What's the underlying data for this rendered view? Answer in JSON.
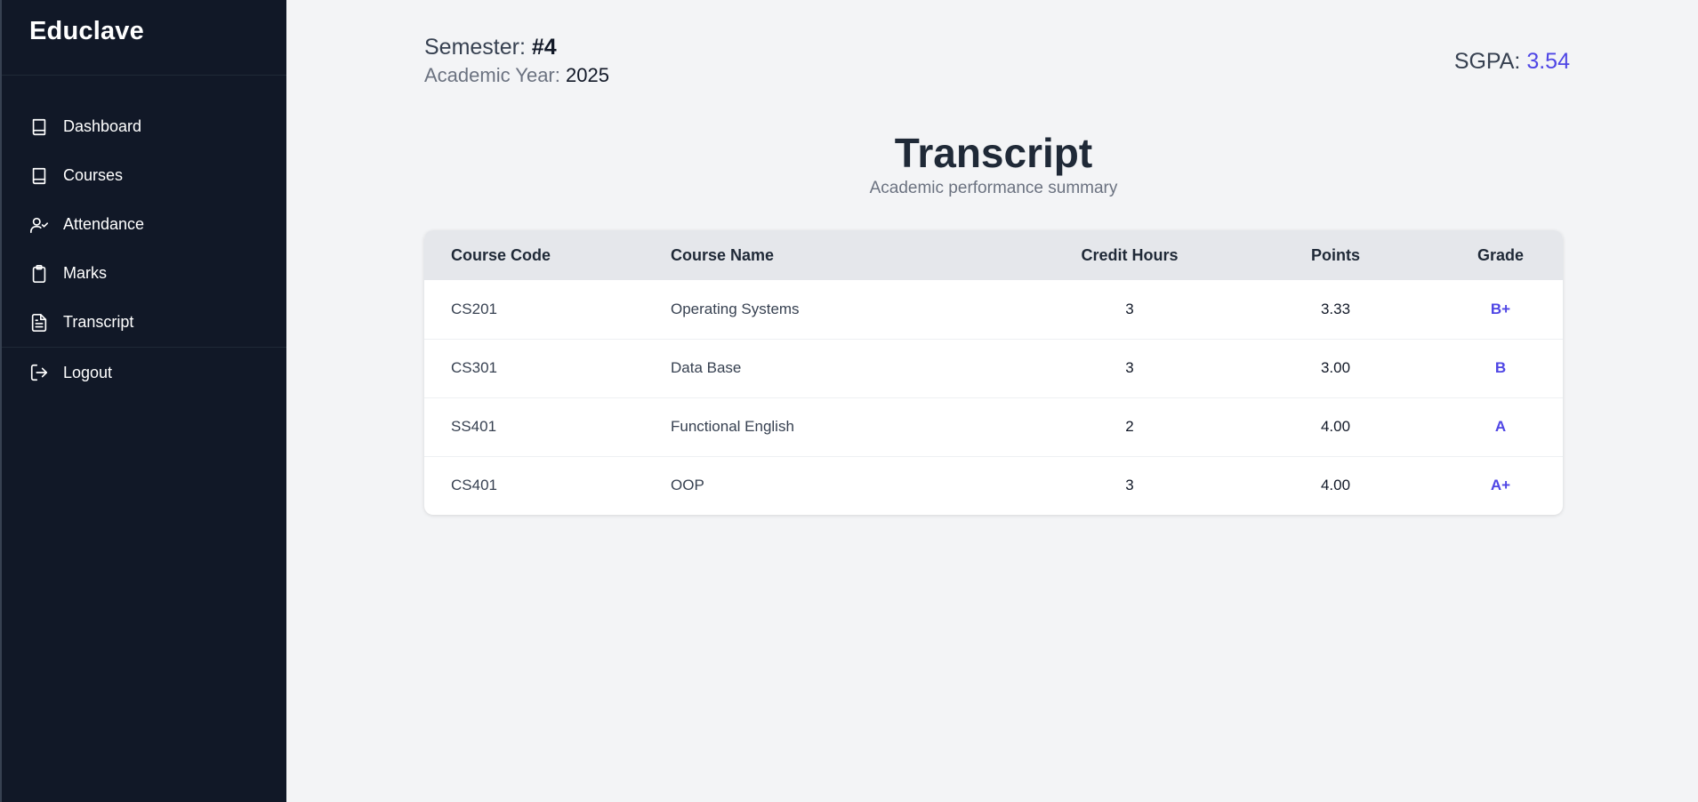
{
  "sidebar": {
    "brand": "Educlave",
    "items": [
      {
        "label": "Dashboard",
        "icon": "book-icon"
      },
      {
        "label": "Courses",
        "icon": "book-icon"
      },
      {
        "label": "Attendance",
        "icon": "user-check-icon"
      },
      {
        "label": "Marks",
        "icon": "clipboard-icon"
      },
      {
        "label": "Transcript",
        "icon": "file-text-icon"
      }
    ],
    "logout": {
      "label": "Logout",
      "icon": "log-out-icon"
    }
  },
  "header": {
    "semester_label": "Semester:",
    "semester_value": "#4",
    "year_label": "Academic Year:",
    "year_value": "2025",
    "sgpa_label": "SGPA:",
    "sgpa_value": "3.54"
  },
  "page": {
    "title": "Transcript",
    "subtitle": "Academic performance summary"
  },
  "table": {
    "columns": [
      "Course Code",
      "Course Name",
      "Credit Hours",
      "Points",
      "Grade"
    ],
    "rows": [
      {
        "code": "CS201",
        "name": "Operating Systems",
        "credits": "3",
        "points": "3.33",
        "grade": "B+"
      },
      {
        "code": "CS301",
        "name": "Data Base",
        "credits": "3",
        "points": "3.00",
        "grade": "B"
      },
      {
        "code": "SS401",
        "name": "Functional English",
        "credits": "2",
        "points": "4.00",
        "grade": "A"
      },
      {
        "code": "CS401",
        "name": "OOP",
        "credits": "3",
        "points": "4.00",
        "grade": "A+"
      }
    ]
  },
  "colors": {
    "sidebar_bg": "#111827",
    "page_bg": "#f3f4f6",
    "accent": "#4f46e5"
  }
}
